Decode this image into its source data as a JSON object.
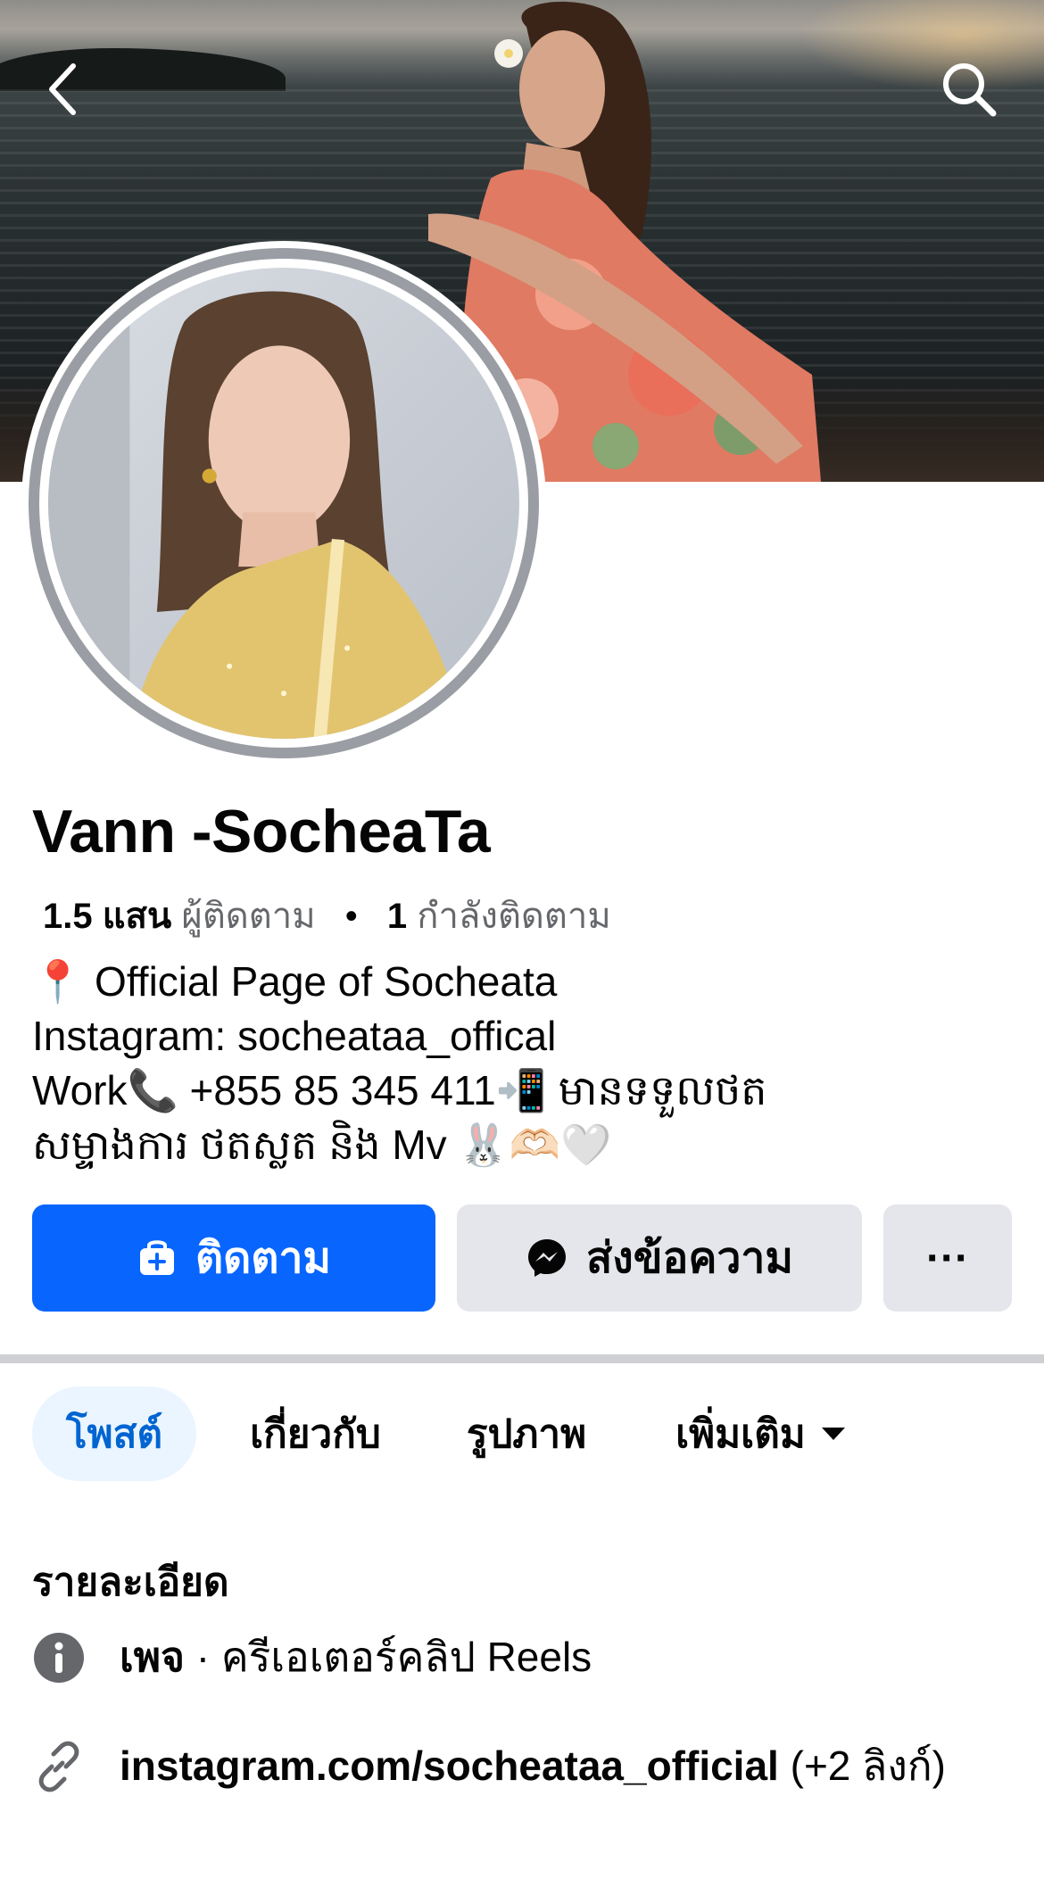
{
  "header": {
    "back_icon": "chevron-left-icon",
    "search_icon": "search-icon"
  },
  "profile": {
    "name": "Vann -SocheaTa",
    "stats": {
      "followers_count": "1.5 แสน",
      "followers_label": "ผู้ติดตาม",
      "separator": "•",
      "following_count": "1",
      "following_label": "กำลังติดตาม"
    },
    "bio": [
      "📍 Official Page of Socheata",
      "Instagram: socheataa_offical",
      "Work📞 +855 85 345 411📲 មានទទួលថត",
      "សម្ទាងការ ថតស្លត និង Mv 🐰🫶🏻🤍"
    ]
  },
  "actions": {
    "follow_label": "ติดตาม",
    "message_label": "ส่งข้อความ",
    "more_label": "···",
    "accent_color": "#0866ff"
  },
  "tabs": [
    {
      "label": "โพสต์",
      "active": true
    },
    {
      "label": "เกี่ยวกับ",
      "active": false
    },
    {
      "label": "รูปภาพ",
      "active": false
    },
    {
      "label": "เพิ่มเติม",
      "active": false
    }
  ],
  "details": {
    "title": "รายละเอียด",
    "category_prefix": "เพจ",
    "category_text": " · ครีเอเตอร์คลิป Reels",
    "link_text": "instagram.com/socheataa_official",
    "link_extra": " (+2 ลิงก์)"
  }
}
